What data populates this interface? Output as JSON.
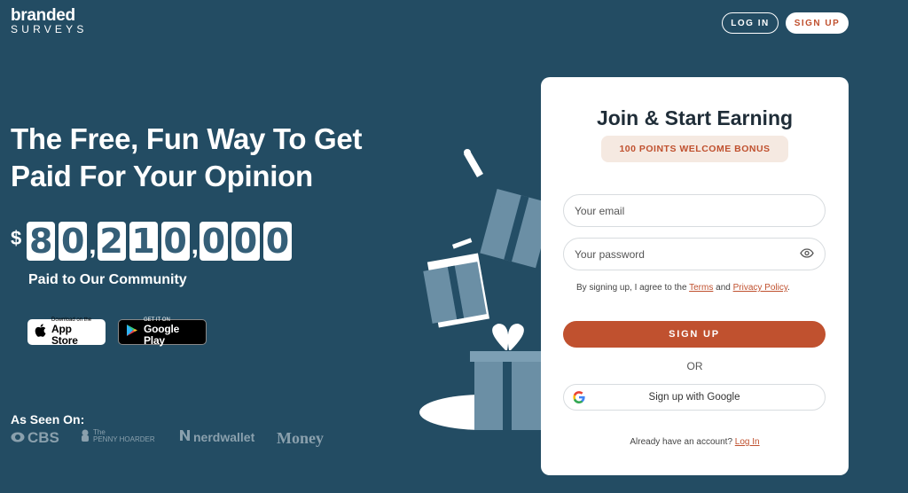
{
  "brand": {
    "top": "branded",
    "bottom": "SURVEYS"
  },
  "header": {
    "login_label": "LOG IN",
    "signup_label": "SIGN UP"
  },
  "hero": {
    "title": "The Free, Fun Way To Get Paid For Your Opinion",
    "currency": "$",
    "counter": "80,210,000",
    "paid_text": "Paid to Our Community"
  },
  "badges": {
    "appstore_small": "Download on the",
    "appstore_big": "App Store",
    "googleplay_small": "GET IT ON",
    "googleplay_big": "Google Play"
  },
  "press": {
    "title": "As Seen On:",
    "cbs": "CBS",
    "penny_small": "The",
    "penny": "PENNY HOARDER",
    "nerdwallet": "nerdwallet",
    "money": "Money"
  },
  "form": {
    "title": "Join & Start Earning",
    "bonus": "100 POINTS WELCOME BONUS",
    "email_placeholder": "Your email",
    "password_placeholder": "Your password",
    "terms_prefix": "By signing up, I agree to the ",
    "terms_link": "Terms",
    "terms_and": " and ",
    "privacy_link": "Privacy Policy",
    "terms_suffix": ".",
    "submit_label": "SIGN UP",
    "or_label": "OR",
    "google_label": "Sign up with Google",
    "already_text": "Already have an account? ",
    "login_link": "Log In"
  },
  "colors": {
    "background": "#234c63",
    "accent": "#c0512f",
    "card": "#ffffff"
  }
}
